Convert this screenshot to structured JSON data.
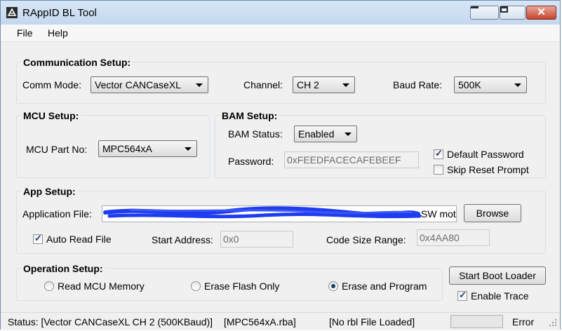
{
  "window": {
    "title": "RAppID BL Tool"
  },
  "menu": {
    "items": [
      "File",
      "Help"
    ]
  },
  "comm_setup": {
    "title": "Communication Setup:",
    "comm_mode_label": "Comm Mode:",
    "comm_mode_value": "Vector CANCaseXL",
    "channel_label": "Channel:",
    "channel_value": "CH 2",
    "baud_label": "Baud Rate:",
    "baud_value": "500K"
  },
  "mcu_setup": {
    "title": "MCU Setup:",
    "part_label": "MCU Part No:",
    "part_value": "MPC564xA"
  },
  "bam_setup": {
    "title": "BAM Setup:",
    "status_label": "BAM Status:",
    "status_value": "Enabled",
    "password_label": "Password:",
    "password_value": "0xFEEDFACECAFEBEEF",
    "default_password_label": "Default Password",
    "default_password_checked": true,
    "skip_reset_label": "Skip Reset Prompt",
    "skip_reset_checked": false
  },
  "app_setup": {
    "title": "App Setup:",
    "file_label": "Application File:",
    "file_value": "SW mot",
    "browse_label": "Browse",
    "auto_read_label": "Auto Read File",
    "auto_read_checked": true,
    "start_label": "Start Address:",
    "start_value": "0x0",
    "size_label": "Code Size Range:",
    "size_value": "0x4AA80"
  },
  "operation_setup": {
    "title": "Operation Setup:",
    "options": [
      "Read MCU Memory",
      "Erase Flash Only",
      "Erase and Program"
    ],
    "selected_index": 2,
    "start_button_label": "Start Boot Loader",
    "enable_trace_label": "Enable Trace",
    "enable_trace_checked": true
  },
  "status": {
    "main": "Status: [Vector CANCaseXL CH 2 (500KBaud)]",
    "rba": "[MPC564xA.rba]",
    "rbl": "[No rbl File Loaded]",
    "error": "Error",
    "progress_fraction": 0
  },
  "colors": {
    "redaction": "#1e3cf0",
    "progress_fill": "#06b025",
    "title_bar": "#c9dcf1"
  }
}
